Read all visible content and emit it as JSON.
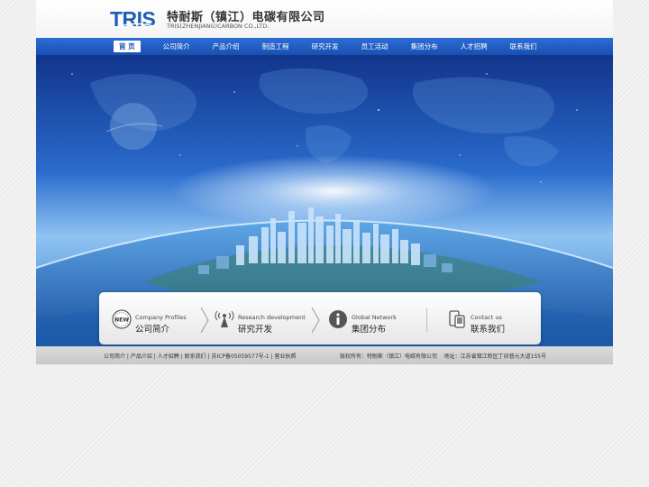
{
  "header": {
    "company_cn": "特耐斯（镇江）电碳有限公司",
    "company_en": "TRIS(ZHENJIANG)CARBON CO.,LTD."
  },
  "logo": {
    "text": "TRIS",
    "color": "#1e5fb4"
  },
  "nav": {
    "items": [
      {
        "label": "首 页",
        "active": true
      },
      {
        "label": "公司简介"
      },
      {
        "label": "产品介绍"
      },
      {
        "label": "制造工程"
      },
      {
        "label": "研究开发"
      },
      {
        "label": "员工活动"
      },
      {
        "label": "集团分布"
      },
      {
        "label": "人才招聘"
      },
      {
        "label": "联系我们"
      }
    ]
  },
  "services": [
    {
      "en": "Company Profiles",
      "cn": "公司简介",
      "icon": "new-badge-icon"
    },
    {
      "en": "Research development",
      "cn": "研究开发",
      "icon": "antenna-icon"
    },
    {
      "en": "Global Network",
      "cn": "集团分布",
      "icon": "info-icon"
    },
    {
      "en": "Contact us",
      "cn": "联系我们",
      "icon": "phone-icon"
    }
  ],
  "footer": {
    "links": [
      "公司简介",
      "产品介绍",
      "人才招聘",
      "联系我们",
      "苏ICP备05059577号-1",
      "营业执照"
    ],
    "separator": " | ",
    "copyright": "版权所有：特耐斯（镇江）电碳有限公司",
    "address": "地址：江苏省镇江新区丁卯普元大道155号"
  },
  "colors": {
    "nav": "#1a4fb2",
    "accent": "#1e5fb4",
    "footer": "#d0d0d0"
  }
}
